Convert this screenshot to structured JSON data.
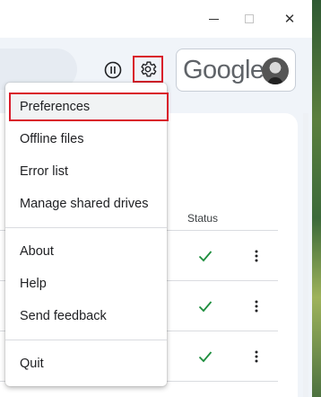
{
  "window": {
    "minimize_icon": "minimize-icon",
    "maximize_icon": "maximize-icon",
    "close_icon": "close-icon",
    "close_glyph": "✕"
  },
  "toolbar": {
    "pause_icon": "pause-icon",
    "settings_icon": "gear-icon"
  },
  "account": {
    "brand": "Google",
    "avatar": "avatar"
  },
  "table": {
    "status_header": "Status",
    "rows": [
      {
        "status_icon": "check-icon",
        "more_icon": "more-vert-icon"
      },
      {
        "status_icon": "check-icon",
        "more_icon": "more-vert-icon"
      },
      {
        "status_icon": "check-icon",
        "more_icon": "more-vert-icon"
      }
    ]
  },
  "menu": {
    "items": [
      {
        "label": "Preferences",
        "highlighted": true
      },
      {
        "label": "Offline files"
      },
      {
        "label": "Error list"
      },
      {
        "label": "Manage shared drives"
      },
      {
        "label": "About"
      },
      {
        "label": "Help"
      },
      {
        "label": "Send feedback"
      },
      {
        "label": "Quit"
      }
    ]
  },
  "colors": {
    "highlight_outline": "#d91b2a",
    "check_green": "#1e8e3e"
  }
}
